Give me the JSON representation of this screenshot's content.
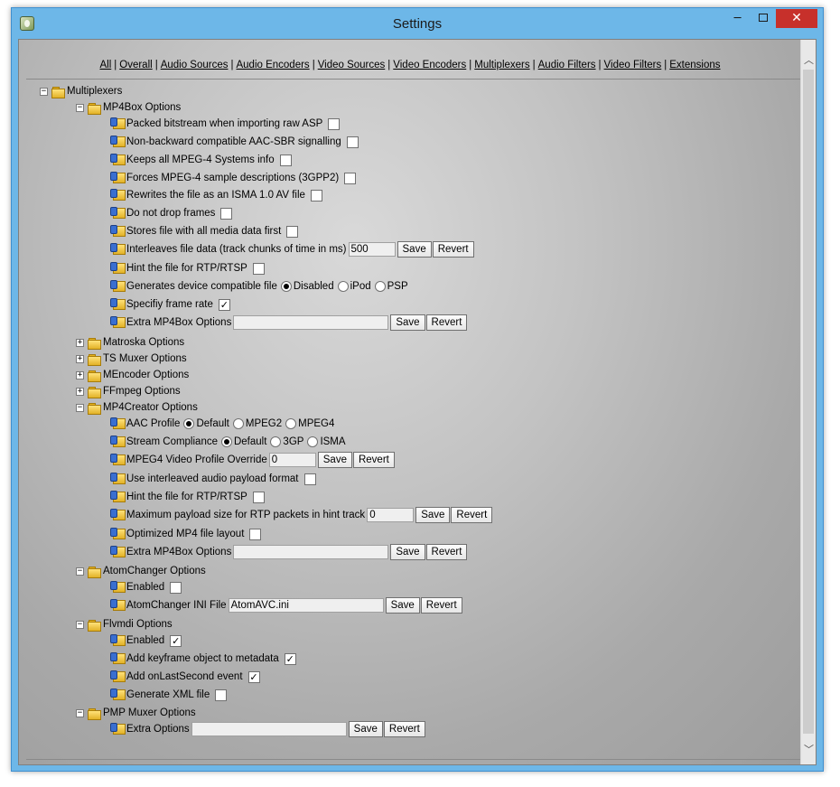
{
  "window": {
    "title": "Settings"
  },
  "controls": {
    "minimize": "─",
    "close": "✕"
  },
  "nav": [
    "All",
    "Overall",
    "Audio Sources",
    "Audio Encoders",
    "Video Sources",
    "Video Encoders",
    "Multiplexers",
    "Audio Filters",
    "Video Filters",
    "Extensions"
  ],
  "tree": {
    "root": {
      "label": "Multiplexers",
      "expander": "−"
    },
    "mp4box": {
      "label": "MP4Box Options",
      "expander": "−",
      "packed": "Packed bitstream when importing raw ASP",
      "nonback": "Non-backward compatible AAC-SBR signalling",
      "keeps": "Keeps all MPEG-4 Systems info",
      "forces": "Forces MPEG-4 sample descriptions (3GPP2)",
      "rewrites": "Rewrites the file as an ISMA 1.0 AV file",
      "nodrop": "Do not drop frames",
      "stores": "Stores file with all media data first",
      "interleaves": "Interleaves file data (track chunks of time in ms)",
      "interleaves_value": "500",
      "hint": "Hint the file for RTP/RTSP",
      "device": "Generates device compatible file",
      "device_options": [
        "Disabled",
        "iPod",
        "PSP"
      ],
      "framerate": "Specifiy frame rate",
      "extra": "Extra MP4Box Options",
      "extra_value": ""
    },
    "matroska": {
      "label": "Matroska Options",
      "expander": "+"
    },
    "tsmuxer": {
      "label": "TS Muxer Options",
      "expander": "+"
    },
    "mencoder": {
      "label": "MEncoder Options",
      "expander": "+"
    },
    "ffmpeg": {
      "label": "FFmpeg Options",
      "expander": "+"
    },
    "mp4creator": {
      "label": "MP4Creator Options",
      "expander": "−",
      "aac": "AAC Profile",
      "aac_options": [
        "Default",
        "MPEG2",
        "MPEG4"
      ],
      "stream": "Stream Compliance",
      "stream_options": [
        "Default",
        "3GP",
        "ISMA"
      ],
      "override": "MPEG4 Video Profile Override",
      "override_value": "0",
      "interleaved": "Use interleaved audio payload format",
      "hint": "Hint the file for RTP/RTSP",
      "payload": "Maximum payload size for RTP packets in hint track",
      "payload_value": "0",
      "optimized": "Optimized MP4 file layout",
      "extra": "Extra MP4Box Options",
      "extra_value": ""
    },
    "atomchanger": {
      "label": "AtomChanger Options",
      "expander": "−",
      "enabled": "Enabled",
      "ini": "AtomChanger INI File",
      "ini_value": "AtomAVC.ini"
    },
    "flvmdi": {
      "label": "Flvmdi Options",
      "expander": "−",
      "enabled": "Enabled",
      "keyframe": "Add keyframe object to metadata",
      "lastsecond": "Add onLastSecond event",
      "xml": "Generate XML file"
    },
    "pmp": {
      "label": "PMP Muxer Options",
      "expander": "−",
      "extra": "Extra Options",
      "extra_value": ""
    }
  },
  "checks": {
    "mp4box_packed": "",
    "mp4box_nonback": "",
    "mp4box_keeps": "",
    "mp4box_forces": "",
    "mp4box_rewrites": "",
    "mp4box_nodrop": "",
    "mp4box_stores": "",
    "mp4box_hint": "",
    "mp4box_framerate": "✓",
    "mp4c_interleaved": "",
    "mp4c_hint": "",
    "mp4c_optimized": "",
    "atom_enabled": "",
    "flv_enabled": "✓",
    "flv_keyframe": "✓",
    "flv_lastsecond": "✓",
    "flv_xml": ""
  },
  "buttons": {
    "save": "Save",
    "revert": "Revert"
  },
  "scrollbar": {
    "up": "︿",
    "down": "﹀"
  }
}
